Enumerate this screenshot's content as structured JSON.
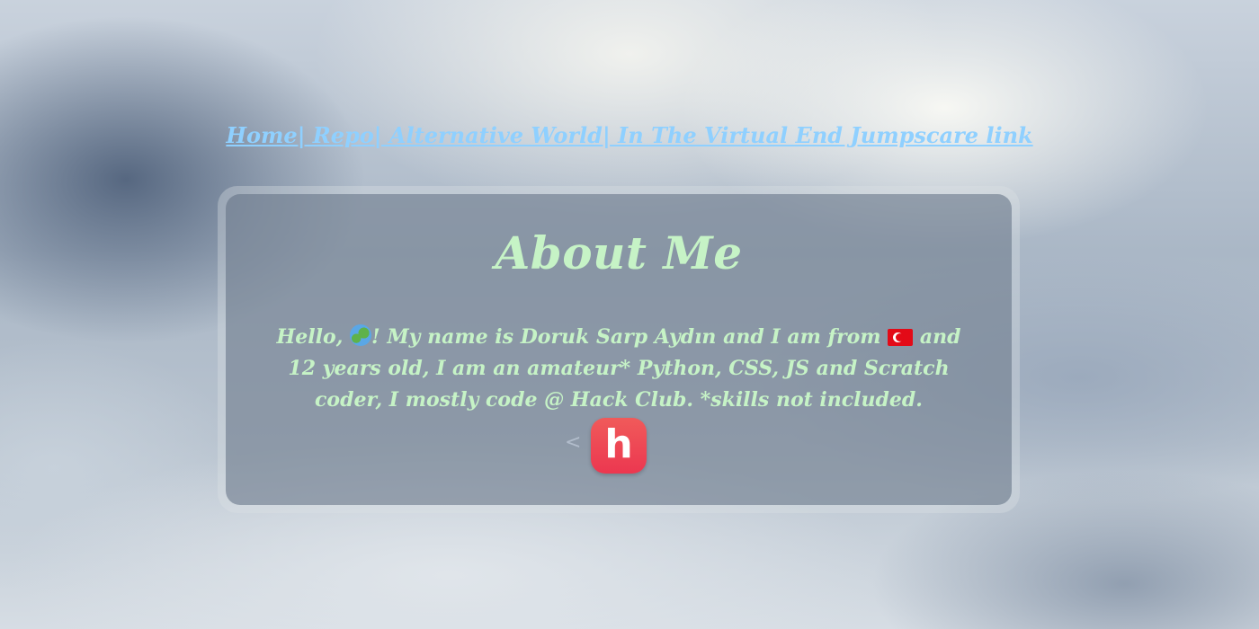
{
  "nav": {
    "links": [
      {
        "label": "Home"
      },
      {
        "label": " Repo"
      },
      {
        "label": " Alternative World"
      },
      {
        "label": " In The Virtual End Jumpscare link"
      }
    ],
    "separator": "|"
  },
  "about": {
    "title": "About Me",
    "text_part1": "Hello, ",
    "globe_icon": "globe-emoji",
    "text_part2": "! My name is Doruk Sarp Aydın and I am from ",
    "flag_icon": "turkey-flag-emoji",
    "text_part3": " and 12 years old, I am an amateur* Python, CSS, JS and Scratch coder, I mostly code @ Hack Club. *skills not included."
  },
  "carousel": {
    "prev_label": "<",
    "logo_letter": "h",
    "logo_name": "hack-club-logo"
  },
  "colors": {
    "nav_link": "#8fd0ff",
    "about_text": "#c6f3c6",
    "logo_red": "#ec3750"
  }
}
